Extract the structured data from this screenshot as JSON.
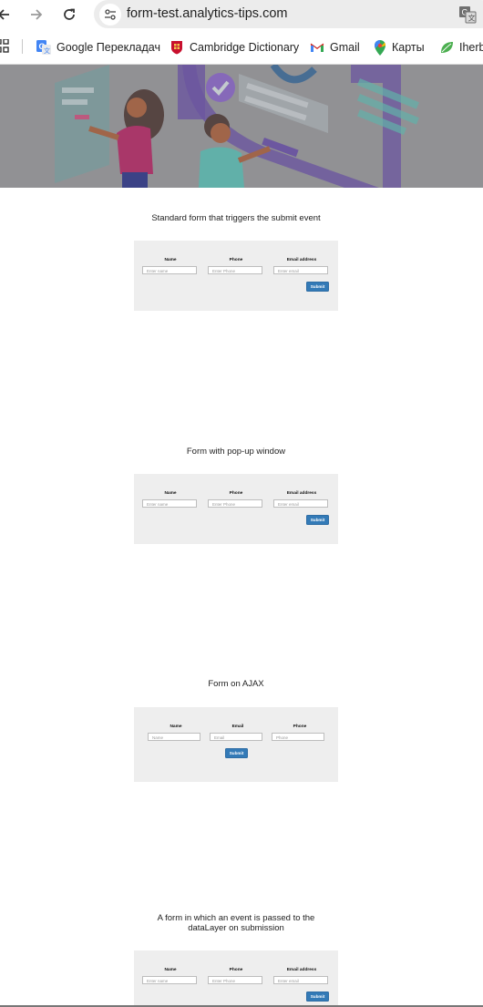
{
  "browser": {
    "url": "form-test.analytics-tips.com",
    "bookmarks": [
      {
        "label": "Google Перекладач",
        "icon": "google-translate-icon"
      },
      {
        "label": "Cambridge Dictionary",
        "icon": "cambridge-icon"
      },
      {
        "label": "Gmail",
        "icon": "gmail-icon"
      },
      {
        "label": "Карты",
        "icon": "maps-pin-icon"
      },
      {
        "label": "Iherb",
        "icon": "iherb-leaf-icon"
      }
    ]
  },
  "sections": [
    {
      "title": "Standard form that triggers the submit event",
      "fields": [
        {
          "label": "Name",
          "placeholder": "Enter name"
        },
        {
          "label": "Phone",
          "placeholder": "Enter Phone"
        },
        {
          "label": "Email address",
          "placeholder": "Enter email"
        }
      ],
      "submit": "Submit"
    },
    {
      "title": "Form with pop-up window",
      "fields": [
        {
          "label": "Name",
          "placeholder": "Enter name"
        },
        {
          "label": "Phone",
          "placeholder": "Enter Phone"
        },
        {
          "label": "Email address",
          "placeholder": "Enter email"
        }
      ],
      "submit": "Submit"
    },
    {
      "title": "Form on AJAX",
      "fields": [
        {
          "label": "Name",
          "placeholder": "Name"
        },
        {
          "label": "Email",
          "placeholder": "Email"
        },
        {
          "label": "Phone",
          "placeholder": "Phone"
        }
      ],
      "submit": "Submit"
    },
    {
      "title_line1": "A form in which an event is passed to the",
      "title_line2": "dataLayer on submission",
      "fields": [
        {
          "label": "Name",
          "placeholder": "Enter name"
        },
        {
          "label": "Phone",
          "placeholder": "Enter Phone"
        },
        {
          "label": "Email address",
          "placeholder": "Enter email"
        }
      ],
      "submit": "Submit"
    }
  ],
  "colors": {
    "submit_button": "#337ab7",
    "form_panel": "#eeeeee",
    "omnibox": "#ececec"
  }
}
